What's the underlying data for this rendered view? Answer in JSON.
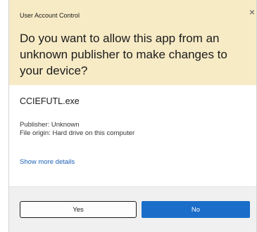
{
  "dialog": {
    "window_title": "User Account Control",
    "close_glyph": "×",
    "question": "Do you want to allow this app from an unknown publisher to make changes to your device?",
    "app_name": "CCIEFUTL.exe",
    "publisher": "Publisher: Unknown",
    "file_origin": "File origin: Hard drive on this computer",
    "more_details_link": "Show more details",
    "yes_label": "Yes",
    "no_label": "No"
  },
  "colors": {
    "header_bg": "#f7ebc6",
    "footer_bg": "#f0f0f0",
    "primary_button": "#1a6dc9",
    "link": "#1a5fb4"
  },
  "icons": {
    "close": "close-icon"
  }
}
